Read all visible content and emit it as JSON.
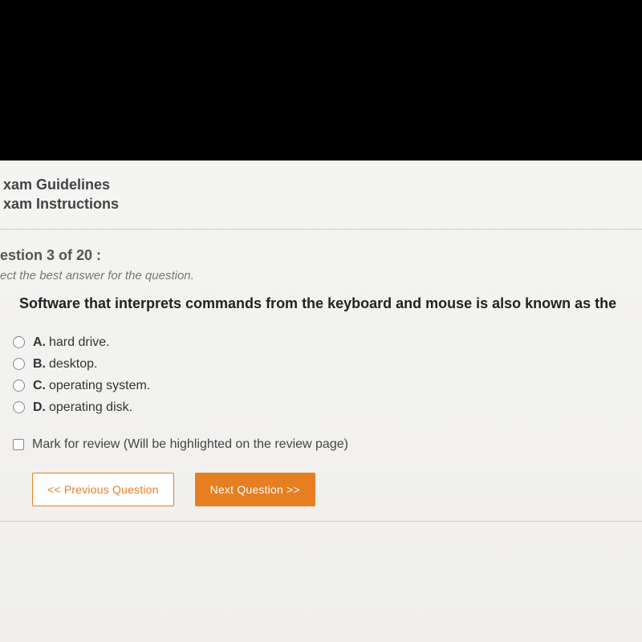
{
  "header": {
    "guidelines": "xam Guidelines",
    "instructions": "xam Instructions"
  },
  "question": {
    "number_label": "estion 3 of 20 :",
    "instruction": "ect the best answer for the question.",
    "text": "Software that interprets commands from the keyboard and mouse is also known as the"
  },
  "options": [
    {
      "letter": "A.",
      "text": "hard drive."
    },
    {
      "letter": "B.",
      "text": "desktop."
    },
    {
      "letter": "C.",
      "text": "operating system."
    },
    {
      "letter": "D.",
      "text": "operating disk."
    }
  ],
  "review": {
    "label": "Mark for review (Will be highlighted on the review page)"
  },
  "nav": {
    "prev": "<< Previous Question",
    "next": "Next Question >>"
  },
  "colors": {
    "accent": "#e67e22"
  }
}
